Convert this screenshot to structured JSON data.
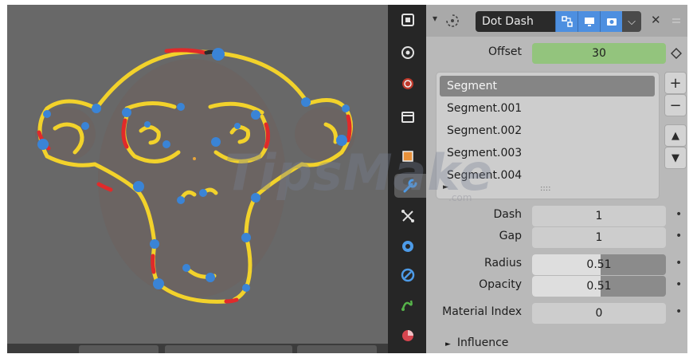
{
  "header": {
    "modifier_name": "Dot Dash",
    "close_symbol": "✕",
    "collapse_symbol": "▾",
    "menu_symbol": "⌵"
  },
  "properties": {
    "offset_label": "Offset",
    "offset_value": "30",
    "segments": [
      "Segment",
      "Segment.001",
      "Segment.002",
      "Segment.003",
      "Segment.004"
    ],
    "selected_segment": "Segment",
    "list_resize_grip": "::::",
    "add_symbol": "+",
    "remove_symbol": "−",
    "move_up_symbol": "▲",
    "move_down_symbol": "▼",
    "dash_label": "Dash",
    "dash_value": "1",
    "gap_label": "Gap",
    "gap_value": "1",
    "radius_label": "Radius",
    "radius_value": "0.51",
    "radius_fraction": 0.51,
    "opacity_label": "Opacity",
    "opacity_value": "0.51",
    "opacity_fraction": 0.51,
    "material_index_label": "Material Index",
    "material_index_value": "0",
    "influence_label": "Influence",
    "influence_symbol": "►",
    "animate_dot": "•"
  },
  "watermark": {
    "text": "TipsMake",
    "sub": ".com"
  },
  "colors": {
    "offset_highlight": "#93c47d",
    "stroke_yellow": "#f2d22b",
    "stroke_red": "#e02a2a",
    "stroke_blue": "#3a84d6"
  },
  "icons": {
    "tabs": [
      "tool-icon",
      "render-icon",
      "output-icon",
      "scene-icon",
      "world-icon",
      "collection-icon",
      "object-icon",
      "modifiers-icon",
      "particles-icon",
      "physics-icon",
      "constraints-icon",
      "object-data-icon",
      "material-icon"
    ]
  }
}
